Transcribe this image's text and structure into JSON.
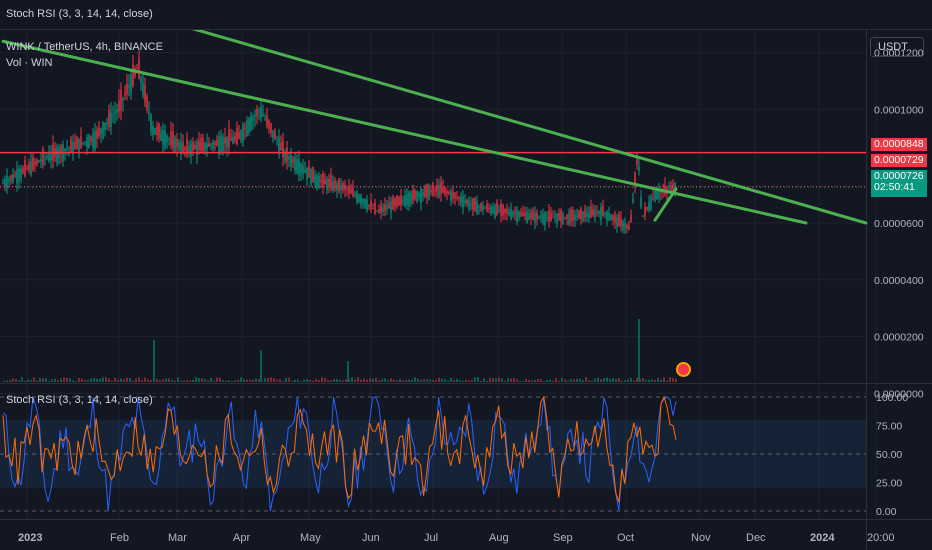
{
  "top_bar": {
    "label": "Stoch RSI (3, 3, 14, 14, close)"
  },
  "legend": {
    "symbol": "WINK / TetherUS, 4h, BINANCE",
    "volume": "Vol · WIN",
    "stoch": "Stoch RSI (3, 3, 14, 14, close)"
  },
  "currency": "USDT",
  "price_tags": {
    "high_line": "0.0000848",
    "mid_line": "0.0000729",
    "last_price": "0.0000726",
    "countdown": "02:50:41"
  },
  "colors": {
    "background": "#131722",
    "grid": "#1e222d",
    "price_line": "#f23645",
    "channel_lines": "#4caf50",
    "stoch_k": "#2962ff",
    "stoch_d": "#ff6d00",
    "stoch_band": "#1e3a5f",
    "last_price_tag": "#089981"
  },
  "chart_data": [
    {
      "type": "line",
      "subtype": "candlestick",
      "title": "WINK / TetherUS, 4h, BINANCE",
      "yticks": [
        "0.0001200",
        "0.0001000",
        "0.0000600",
        "0.0000400",
        "0.0000200",
        "0.0000000"
      ],
      "ylim": [
        -2e-06,
        0.000124
      ],
      "x_ticks": [
        "2023",
        "Feb",
        "Mar",
        "Apr",
        "May",
        "Jun",
        "Jul",
        "Aug",
        "Sep",
        "Oct",
        "Nov",
        "Dec",
        "2024",
        "20:00"
      ],
      "price_path": [
        {
          "x": "2023",
          "y": 7.4e-05
        },
        {
          "x": "Jan mid",
          "y": 8.3e-05
        },
        {
          "x": "Feb",
          "y": 9e-05
        },
        {
          "x": "Feb mid",
          "y": 0.0001
        },
        {
          "x": "Feb end",
          "y": 0.000115
        },
        {
          "x": "Mar",
          "y": 9.3e-05
        },
        {
          "x": "Mar mid",
          "y": 8.6e-05
        },
        {
          "x": "Apr",
          "y": 8.8e-05
        },
        {
          "x": "Apr mid",
          "y": 9e-05
        },
        {
          "x": "Apr end",
          "y": 0.0001
        },
        {
          "x": "May",
          "y": 8.4e-05
        },
        {
          "x": "May mid",
          "y": 7.5e-05
        },
        {
          "x": "Jun",
          "y": 7.2e-05
        },
        {
          "x": "Jun mid",
          "y": 6.4e-05
        },
        {
          "x": "Jul",
          "y": 6.9e-05
        },
        {
          "x": "Jul mid",
          "y": 7.2e-05
        },
        {
          "x": "Aug",
          "y": 6.6e-05
        },
        {
          "x": "Aug mid",
          "y": 6.4e-05
        },
        {
          "x": "Sep",
          "y": 6.2e-05
        },
        {
          "x": "Sep mid",
          "y": 6.2e-05
        },
        {
          "x": "Oct",
          "y": 6.4e-05
        },
        {
          "x": "Oct mid",
          "y": 5.8e-05
        },
        {
          "x": "Oct 20",
          "y": 8.5e-05
        },
        {
          "x": "Oct 22",
          "y": 6.2e-05
        },
        {
          "x": "Oct end",
          "y": 7e-05
        },
        {
          "x": "Nov",
          "y": 7.26e-05
        }
      ],
      "horizontal_levels": [
        8.48e-05,
        7.29e-05
      ],
      "trend_lines": [
        {
          "from": {
            "x": "2023",
            "y": 0.000124
          },
          "to": {
            "x": "Dec end",
            "y": 6e-05
          }
        },
        {
          "from": {
            "x": "Feb mid",
            "y": 0.000136
          },
          "to": {
            "x": "2024 mid",
            "y": 6e-05
          }
        },
        {
          "from": {
            "x": "Oct end",
            "y": 6.1e-05
          },
          "to": {
            "x": "Nov",
            "y": 7.2e-05
          }
        }
      ],
      "volume": {
        "name": "Vol · WIN",
        "spikes": [
          {
            "x": "Mar",
            "v": 0.6
          },
          {
            "x": "Apr end",
            "v": 0.45
          },
          {
            "x": "Jun",
            "v": 0.3
          },
          {
            "x": "Oct 20",
            "v": 0.9
          }
        ]
      }
    },
    {
      "type": "line",
      "title": "Stoch RSI (3, 3, 14, 14, close)",
      "yticks": [
        "100.00",
        "75.00",
        "50.00",
        "25.00",
        "0.00"
      ],
      "ylim": [
        0,
        100
      ],
      "bands": [
        20,
        80
      ],
      "series": [
        {
          "name": "K",
          "values": [
            80,
            20,
            95,
            10,
            70,
            30,
            90,
            5,
            60,
            85,
            15,
            100,
            40,
            75,
            10,
            90,
            25,
            80,
            0,
            65,
            95,
            20,
            85,
            10,
            55,
            100,
            30,
            70,
            5,
            90,
            45,
            85,
            15,
            95,
            20,
            60,
            100,
            10,
            75,
            35,
            90,
            5,
            80,
            25,
            100
          ]
        },
        {
          "name": "D",
          "values": [
            70,
            40,
            75,
            35,
            60,
            45,
            70,
            30,
            55,
            70,
            35,
            80,
            50,
            65,
            30,
            75,
            40,
            70,
            20,
            55,
            80,
            40,
            70,
            30,
            50,
            85,
            45,
            60,
            25,
            75,
            50,
            70,
            35,
            80,
            40,
            55,
            85,
            30,
            65,
            45,
            75,
            25,
            70,
            40,
            90
          ]
        }
      ]
    }
  ]
}
